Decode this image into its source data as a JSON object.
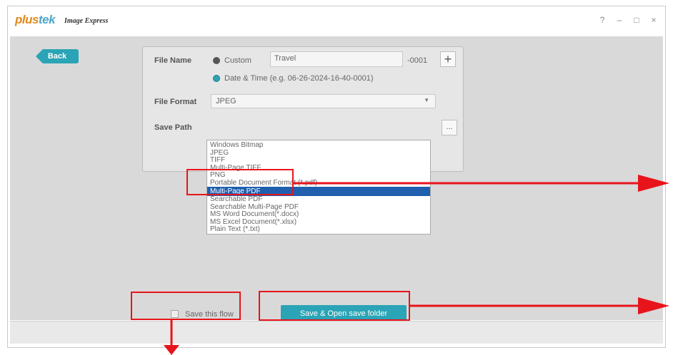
{
  "app": {
    "brand_plus": "plus",
    "brand_tek": "tek",
    "product_name": "Image Express",
    "controls": {
      "help": "?",
      "minimize": "–",
      "maximize": "□",
      "close": "×"
    }
  },
  "nav": {
    "back_label": "Back"
  },
  "file_name": {
    "label": "File Name",
    "custom_label": "Custom",
    "custom_value": "Travel",
    "suffix": "-0001",
    "add_symbol": "+",
    "datetime_label": "Date & Time (e.g. 06-26-2024-16-40-0001)"
  },
  "file_format": {
    "label": "File Format",
    "selected": "JPEG",
    "options": [
      "Windows Bitmap",
      "JPEG",
      "TIFF",
      "Multi-Page TIFF",
      "PNG",
      "Portable Document Format (*.pdf)",
      "Multi-Page PDF",
      "Searchable PDF",
      "Searchable Multi-Page PDF",
      "MS Word Document(*.docx)",
      "MS Excel Document(*.xlsx)",
      "Plain Text (*.txt)"
    ],
    "highlighted_option": "Multi-Page PDF"
  },
  "save_path": {
    "label": "Save Path",
    "browse_label": "..."
  },
  "flow": {
    "save_flow_label": "Save this flow",
    "checked": false
  },
  "actions": {
    "save_open_label": "Save & Open save folder"
  },
  "colors": {
    "accent": "#2aa4b6",
    "highlight": "#1f5fae",
    "annotation": "#e8141b"
  }
}
